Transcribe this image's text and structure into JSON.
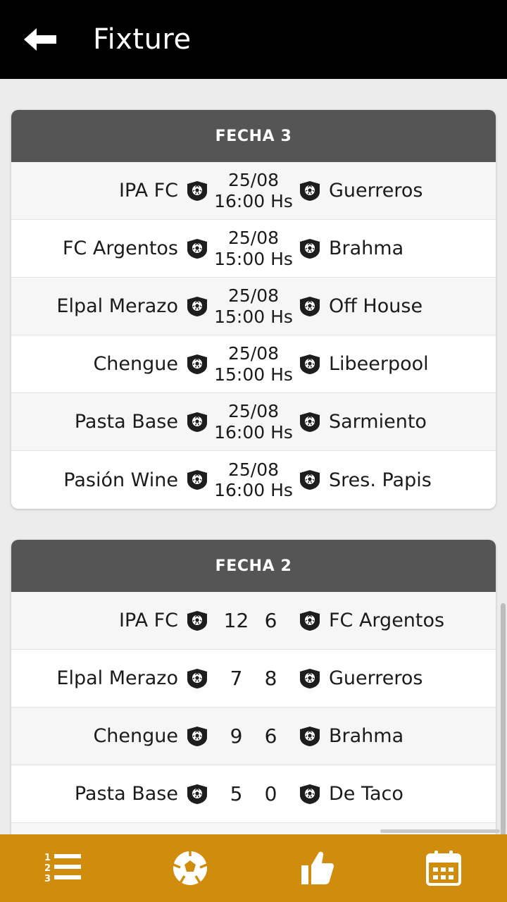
{
  "header": {
    "title": "Fixture",
    "back_icon": "arrow-left-icon"
  },
  "sections": [
    {
      "title": "FECHA 3",
      "type": "upcoming",
      "matches": [
        {
          "home": "IPA FC",
          "away": "Guerreros",
          "date": "25/08",
          "time": "16:00 Hs"
        },
        {
          "home": "FC Argentos",
          "away": "Brahma",
          "date": "25/08",
          "time": "15:00 Hs"
        },
        {
          "home": "Elpal Merazo",
          "away": "Off House",
          "date": "25/08",
          "time": "15:00 Hs"
        },
        {
          "home": "Chengue",
          "away": "Libeerpool",
          "date": "25/08",
          "time": "15:00 Hs"
        },
        {
          "home": "Pasta Base",
          "away": "Sarmiento",
          "date": "25/08",
          "time": "16:00 Hs"
        },
        {
          "home": "Pasión Wine",
          "away": "Sres. Papis",
          "date": "25/08",
          "time": "16:00 Hs"
        }
      ]
    },
    {
      "title": "FECHA 2",
      "type": "played",
      "matches": [
        {
          "home": "IPA FC",
          "away": "FC Argentos",
          "home_score": "12",
          "away_score": "6"
        },
        {
          "home": "Elpal Merazo",
          "away": "Guerreros",
          "home_score": "7",
          "away_score": "8"
        },
        {
          "home": "Chengue",
          "away": "Brahma",
          "home_score": "9",
          "away_score": "6"
        },
        {
          "home": "Pasta Base",
          "away": "De Taco",
          "home_score": "5",
          "away_score": "0"
        }
      ]
    }
  ],
  "bottom_nav": {
    "items": [
      {
        "icon": "numbered-list-icon",
        "name": "tab-standings"
      },
      {
        "icon": "soccer-ball-icon",
        "name": "tab-matches"
      },
      {
        "icon": "thumbs-up-icon",
        "name": "tab-likes"
      },
      {
        "icon": "calendar-icon",
        "name": "tab-fixture"
      }
    ],
    "active_index": 3
  },
  "colors": {
    "appbar_bg": "#000000",
    "section_header_bg": "#555555",
    "nav_bg": "#d08c0c",
    "page_bg": "#ececec"
  }
}
